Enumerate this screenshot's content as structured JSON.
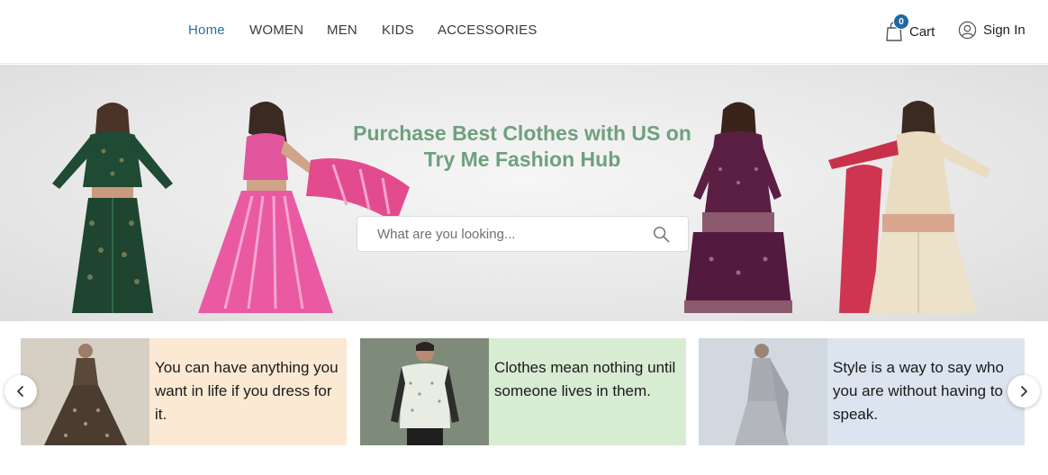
{
  "nav": {
    "items": [
      {
        "label": "Home",
        "active": true
      },
      {
        "label": "WOMEN"
      },
      {
        "label": "MEN"
      },
      {
        "label": "KIDS"
      },
      {
        "label": "ACCESSORIES"
      }
    ]
  },
  "header": {
    "cart_label": "Cart",
    "cart_count": "0",
    "signin_label": "Sign In",
    "cart_icon": "shopping-bag-icon",
    "user_icon": "user-circle-icon"
  },
  "hero": {
    "title_line1": "Purchase Best Clothes with US on",
    "title_line2": "Try Me Fashion Hub",
    "search_placeholder": "What are you looking...",
    "search_icon": "search-icon"
  },
  "cards": [
    {
      "quote": "You can have anything you want in life if you dress for it."
    },
    {
      "quote": "Clothes mean nothing until someone lives in them."
    },
    {
      "quote": "Style is a way to say who you are without having to speak."
    }
  ],
  "colors": {
    "accent": "#2a6f9e",
    "title_green": "#6fa07e",
    "badge": "#1f6aa5",
    "card1_bg": "#fbe9d3",
    "card2_bg": "#d8ebd3",
    "card3_bg": "#dbe4ef"
  }
}
